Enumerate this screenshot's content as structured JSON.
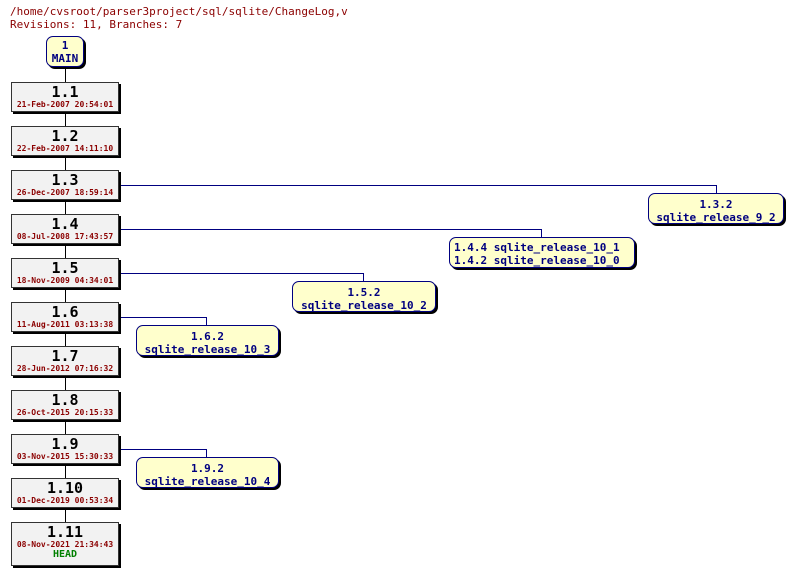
{
  "header": {
    "path": "/home/cvsroot/parser3project/sql/sqlite/ChangeLog,v",
    "summary": "Revisions: 11, Branches: 7"
  },
  "trunk": {
    "number": "1",
    "name": "MAIN"
  },
  "revisions": [
    {
      "rev": "1.1",
      "date": "21-Feb-2007 20:54:01"
    },
    {
      "rev": "1.2",
      "date": "22-Feb-2007 14:11:10"
    },
    {
      "rev": "1.3",
      "date": "26-Dec-2007 18:59:14"
    },
    {
      "rev": "1.4",
      "date": "08-Jul-2008 17:43:57"
    },
    {
      "rev": "1.5",
      "date": "18-Nov-2009 04:34:01"
    },
    {
      "rev": "1.6",
      "date": "11-Aug-2011 03:13:38"
    },
    {
      "rev": "1.7",
      "date": "28-Jun-2012 07:16:32"
    },
    {
      "rev": "1.8",
      "date": "26-Oct-2015 20:15:33"
    },
    {
      "rev": "1.9",
      "date": "03-Nov-2015 15:30:33"
    },
    {
      "rev": "1.10",
      "date": "01-Dec-2019 00:53:34"
    },
    {
      "rev": "1.11",
      "date": "08-Nov-2021 21:34:43",
      "tag": "HEAD"
    }
  ],
  "branches": [
    {
      "from": "1.3",
      "lines": [
        "1.3.2",
        "sqlite_release_9_2"
      ]
    },
    {
      "from": "1.4",
      "lines": [
        "1.4.4 sqlite_release_10_1",
        "1.4.2 sqlite_release_10_0"
      ]
    },
    {
      "from": "1.5",
      "lines": [
        "1.5.2",
        "sqlite_release_10_2"
      ]
    },
    {
      "from": "1.6",
      "lines": [
        "1.6.2",
        "sqlite_release_10_3"
      ]
    },
    {
      "from": "1.9",
      "lines": [
        "1.9.2",
        "sqlite_release_10_4"
      ]
    }
  ],
  "colors": {
    "connector": "#000080",
    "date": "#8b0000",
    "head": "#008000",
    "tag_fill": "#ffffcc",
    "rev_fill": "#f2f2f2"
  }
}
